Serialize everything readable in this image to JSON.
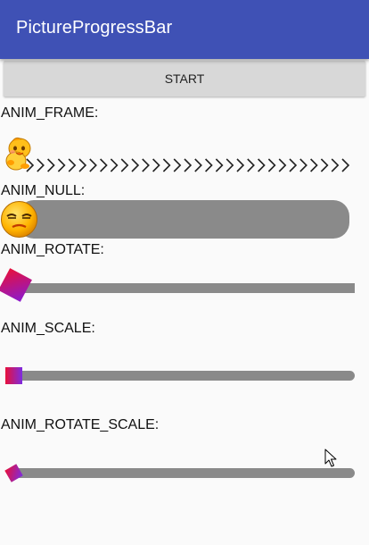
{
  "app": {
    "title": "PictureProgressBar",
    "accent_color": "#3f51b5"
  },
  "start_button": {
    "label": "START"
  },
  "demos": [
    {
      "label": "ANIM_FRAME:",
      "indicator": "chick-mascot-icon",
      "track": "chevron-row"
    },
    {
      "label": "ANIM_NULL:",
      "indicator": "annoyed-face-icon",
      "track": "rounded-grey-bar"
    },
    {
      "label": "ANIM_ROTATE:",
      "indicator": "rotating-gradient-square",
      "track": "grey-bar"
    },
    {
      "label": "ANIM_SCALE:",
      "indicator": "scaling-gradient-square",
      "track": "grey-bar"
    },
    {
      "label": "ANIM_ROTATE_SCALE:",
      "indicator": "rotate-scale-gradient-square",
      "track": "grey-bar"
    }
  ],
  "colors": {
    "track": "#8a8a8a",
    "gradient_start": "#e8103a",
    "gradient_end": "#8a1ad0",
    "chevron": "#222222"
  },
  "icons": {
    "cursor": "mouse-pointer-icon"
  }
}
